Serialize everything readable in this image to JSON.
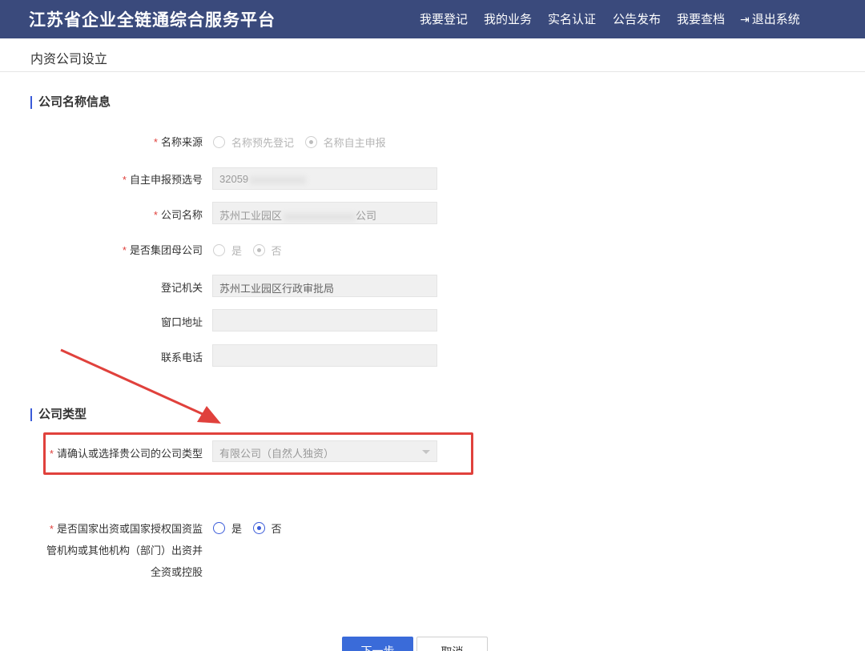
{
  "header": {
    "brand": "江苏省企业全链通综合服务平台",
    "nav": [
      "我要登记",
      "我的业务",
      "实名认证",
      "公告发布",
      "我要查档",
      "退出系统"
    ]
  },
  "subheader": {
    "title": "内资公司设立"
  },
  "section_name": {
    "title": "公司名称信息",
    "name_source": {
      "label": "名称来源",
      "options": [
        "名称预先登记",
        "名称自主申报"
      ],
      "selected": "名称自主申报"
    },
    "pre_number": {
      "label": "自主申报预选号",
      "value": "32059"
    },
    "company_name": {
      "label": "公司名称",
      "prefix": "苏州工业园区",
      "suffix": "公司"
    },
    "group_parent": {
      "label": "是否集团母公司",
      "options": [
        "是",
        "否"
      ],
      "selected": "否"
    },
    "reg_authority": {
      "label": "登记机关",
      "value": "苏州工业园区行政审批局"
    },
    "window_address": {
      "label": "窗口地址",
      "value": ""
    },
    "phone": {
      "label": "联系电话",
      "value": ""
    }
  },
  "section_type": {
    "title": "公司类型",
    "company_type": {
      "label": "请确认或选择贵公司的公司类型",
      "value": "有限公司（自然人独资）"
    },
    "state_owned": {
      "label_lines": [
        "是否国家出资或国家授权国资监",
        "管机构或其他机构（部门）出资并",
        "全资或控股"
      ],
      "options": [
        "是",
        "否"
      ],
      "selected": "否"
    }
  },
  "buttons": {
    "next": "下一步",
    "cancel": "取消"
  },
  "colors": {
    "header": "#3a4a7c",
    "accent": "#3a5bd9",
    "annotation": "#e0413c"
  }
}
